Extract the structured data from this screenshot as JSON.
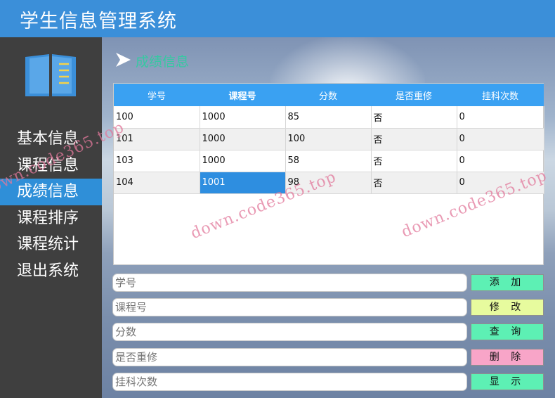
{
  "app": {
    "title": "学生信息管理系统"
  },
  "sidebar": {
    "items": [
      {
        "label": "基本信息"
      },
      {
        "label": "课程信息"
      },
      {
        "label": "成绩信息"
      },
      {
        "label": "课程排序"
      },
      {
        "label": "课程统计"
      },
      {
        "label": "退出系统"
      }
    ],
    "active": "成绩信息"
  },
  "section": {
    "title": "成绩信息"
  },
  "table": {
    "headers": [
      "学号",
      "课程号",
      "分数",
      "是否重修",
      "挂科次数"
    ],
    "rows": [
      [
        "100",
        "1000",
        "85",
        "否",
        "0"
      ],
      [
        "101",
        "1000",
        "100",
        "否",
        "0"
      ],
      [
        "103",
        "1000",
        "58",
        "否",
        "0"
      ],
      [
        "104",
        "1001",
        "98",
        "否",
        "0"
      ]
    ]
  },
  "form": {
    "fields": [
      {
        "placeholder": "学号"
      },
      {
        "placeholder": "课程号"
      },
      {
        "placeholder": "分数"
      },
      {
        "placeholder": "是否重修"
      },
      {
        "placeholder": "挂科次数"
      }
    ],
    "buttons": [
      {
        "label": "添 加",
        "color": "#5df0b4"
      },
      {
        "label": "修 改",
        "color": "#e7fb9e"
      },
      {
        "label": "查 询",
        "color": "#5df0b4"
      },
      {
        "label": "删 除",
        "color": "#f8a5c8"
      },
      {
        "label": "显 示",
        "color": "#5df0b4"
      }
    ]
  },
  "watermark": "down.code365.top",
  "colors": {
    "accent": "#3b8fd9",
    "header": "#3aa1f2",
    "sidebar": "#3f3f3f",
    "section_title": "#35c9a2"
  }
}
